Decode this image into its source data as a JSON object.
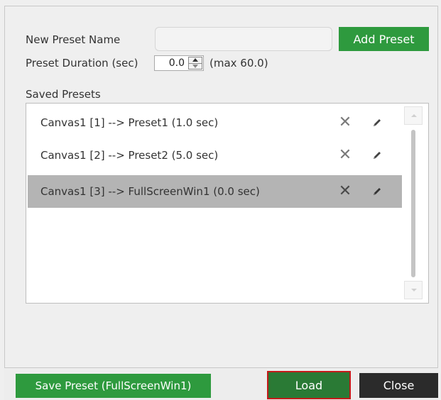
{
  "form": {
    "new_preset_label": "New Preset Name",
    "new_preset_value": "",
    "add_preset_label": "Add Preset",
    "duration_label": "Preset Duration (sec)",
    "duration_value": "0.0",
    "duration_max": "(max 60.0)"
  },
  "saved": {
    "title": "Saved Presets",
    "items": [
      {
        "label": "Canvas1 [1] --> Preset1 (1.0 sec)",
        "delete": "✕",
        "selected": false
      },
      {
        "label": "Canvas1 [2] --> Preset2 (5.0 sec)",
        "delete": "✕",
        "selected": false
      },
      {
        "label": "Canvas1 [3] --> FullScreenWin1 (0.0 sec)",
        "delete": "✕",
        "selected": true
      }
    ]
  },
  "footer": {
    "save_label": "Save Preset (FullScreenWin1)",
    "load_label": "Load",
    "close_label": "Close"
  },
  "colors": {
    "accent_green": "#2e9a3e",
    "selected_row": "#b4b4b4",
    "dark_button": "#2b2b2b",
    "focus_outline": "#c41a1a"
  },
  "icons": {
    "delete": "close-icon",
    "edit": "pencil-icon",
    "spin_up": "chevron-up-icon",
    "spin_down": "chevron-down-icon"
  }
}
